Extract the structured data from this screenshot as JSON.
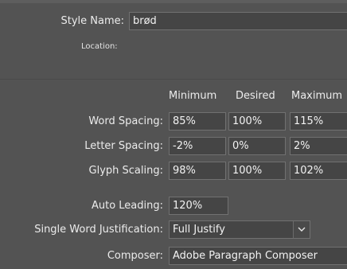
{
  "style_name": {
    "label": "Style Name:",
    "value": "brød"
  },
  "location": {
    "label": "Location:"
  },
  "columns": {
    "minimum": "Minimum",
    "desired": "Desired",
    "maximum": "Maximum"
  },
  "rows": {
    "word_spacing": {
      "label": "Word Spacing:",
      "minimum": "85%",
      "desired": "100%",
      "maximum": "115%"
    },
    "letter_spacing": {
      "label": "Letter Spacing:",
      "minimum": "-2%",
      "desired": "0%",
      "maximum": "2%"
    },
    "glyph_scaling": {
      "label": "Glyph Scaling:",
      "minimum": "98%",
      "desired": "100%",
      "maximum": "102%"
    }
  },
  "auto_leading": {
    "label": "Auto Leading:",
    "value": "120%"
  },
  "single_word_justification": {
    "label": "Single Word Justification:",
    "value": "Full Justify",
    "icon": "chevron-down-icon"
  },
  "composer": {
    "label": "Composer:",
    "value": "Adobe Paragraph Composer"
  }
}
